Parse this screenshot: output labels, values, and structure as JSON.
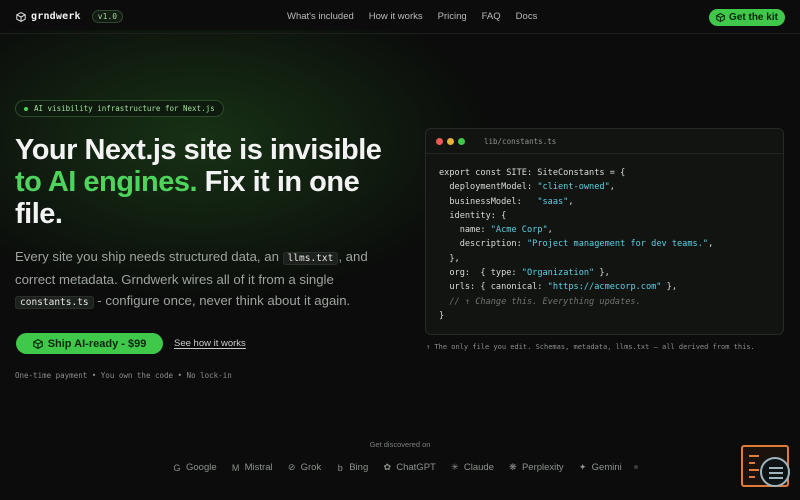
{
  "nav": {
    "logo": "grndwerk",
    "version": "v1.0",
    "links": [
      "What's included",
      "How it works",
      "Pricing",
      "FAQ",
      "Docs"
    ],
    "cta": "Get the kit"
  },
  "hero": {
    "badge": "AI visibility infrastructure for Next.js",
    "headline_part1": "Your Next.js site is invisible ",
    "headline_accent": "to AI engines.",
    "headline_part2": " Fix it in one file.",
    "sub_part1": "Every site you ship needs structured data, an ",
    "sub_chip1": "llms.txt",
    "sub_part2": ", and correct metadata. Grndwerk wires all of it from a single ",
    "sub_chip2": "constants.ts",
    "sub_part3": " - configure once, never think about it again.",
    "cta_primary": "Ship AI-ready - $99",
    "cta_secondary": "See how it works",
    "fineprint": "One-time payment • You own the code • No lock-in"
  },
  "code_window": {
    "filename": "lib/constants.ts",
    "caption": "↑ The only file you edit. Schemas, metadata, llms.txt — all derived from this.",
    "lines": [
      {
        "k": "export const SITE: SiteConstants = {",
        "s": "",
        "t": ""
      },
      {
        "k": "  deploymentModel: ",
        "s": "\"client-owned\"",
        "t": ","
      },
      {
        "k": "  businessModel:   ",
        "s": "\"saas\"",
        "t": ","
      },
      {
        "k": "  identity: {",
        "s": "",
        "t": ""
      },
      {
        "k": "    name: ",
        "s": "\"Acme Corp\"",
        "t": ","
      },
      {
        "k": "    description: ",
        "s": "\"Project management for dev teams.\"",
        "t": ","
      },
      {
        "k": "  },",
        "s": "",
        "t": ""
      },
      {
        "k": "  org:  { type: ",
        "s": "\"Organization\"",
        "t": " },"
      },
      {
        "k": "  urls: { canonical: ",
        "s": "\"https://acmecorp.com\"",
        "t": " },"
      },
      {
        "k": "",
        "s": "",
        "t": "",
        "c": "  // ↑ Change this. Everything updates."
      },
      {
        "k": "}",
        "s": "",
        "t": ""
      }
    ]
  },
  "discovered": {
    "label": "Get discovered on",
    "engines": [
      {
        "name": "Google",
        "icon": "google-icon",
        "glyph": "G"
      },
      {
        "name": "Mistral",
        "icon": "mistral-icon",
        "glyph": "M"
      },
      {
        "name": "Grok",
        "icon": "grok-icon",
        "glyph": "⊘"
      },
      {
        "name": "Bing",
        "icon": "bing-icon",
        "glyph": "b"
      },
      {
        "name": "ChatGPT",
        "icon": "chatgpt-icon",
        "glyph": "✿"
      },
      {
        "name": "Claude",
        "icon": "claude-icon",
        "glyph": "✳"
      },
      {
        "name": "Perplexity",
        "icon": "perplexity-icon",
        "glyph": "❋"
      },
      {
        "name": "Gemini",
        "icon": "gemini-icon",
        "glyph": "✦"
      }
    ]
  },
  "colors": {
    "accent": "#3fc84a",
    "background": "#0b0c0b",
    "string": "#5fd0e4",
    "widget": "#e07b3a"
  }
}
